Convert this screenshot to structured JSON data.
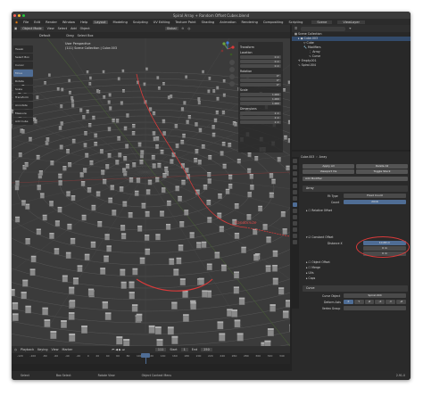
{
  "window": {
    "title": "Spiral Array + Random Offset Cubes.blend"
  },
  "menubar": {
    "items": [
      "File",
      "Edit",
      "Render",
      "Window",
      "Help",
      "Layout",
      "Modeling",
      "Sculpting",
      "UV Editing",
      "Texture Paint",
      "Shading",
      "Animation",
      "Rendering",
      "Compositing",
      "Scripting"
    ],
    "scene": "Scene",
    "view_layer": "ViewLayer"
  },
  "viewport_header": {
    "mode": "Object Mode",
    "menus": [
      "View",
      "Select",
      "Add",
      "Object"
    ],
    "orientation": "Default",
    "drag": "Drag",
    "select_box": "Select Box",
    "transform": "Global"
  },
  "viewport": {
    "info_line1": "User Perspective",
    "info_line2": "(111) Scene Collection | Cube.003",
    "annotation": "Randomize",
    "tools": [
      "Tweak",
      "Select Box",
      "Cursor",
      "Move",
      "Rotate",
      "Scale",
      "Transform",
      "Annotate",
      "Measure",
      "Add Cube"
    ],
    "selected_tool_index": 3
  },
  "npanel": {
    "sections": [
      "Transform",
      "Location",
      "Rotation",
      "Scale",
      "Dimensions"
    ],
    "values": [
      "0 m",
      "0 m",
      "0 m",
      "0°",
      "0°",
      "0°",
      "1.000",
      "1.000",
      "1.000",
      "2 m",
      "2 m",
      "2 m"
    ]
  },
  "timeline": {
    "menus": [
      "Playback",
      "Keying",
      "View",
      "Marker"
    ],
    "current_frame": "111",
    "start_label": "Start",
    "start": "1",
    "end_label": "End",
    "end": "250",
    "ticks": [
      "-120",
      "-100",
      "-80",
      "-60",
      "-40",
      "-20",
      "0",
      "20",
      "40",
      "60",
      "80",
      "100",
      "120",
      "140",
      "160",
      "180",
      "200",
      "220",
      "240",
      "260",
      "280",
      "300",
      "320",
      "340"
    ]
  },
  "statusbar": {
    "items": [
      "Select",
      "Box Select",
      "Rotate View",
      "Object Context Menu"
    ],
    "version": "2.91.0"
  },
  "outliner": {
    "search_placeholder": "",
    "rows": [
      "Scene Collection",
      "Cube.003",
      "Cube",
      "Modifiers",
      "Array",
      "Curve",
      "Empty.001",
      "Spiral.004"
    ]
  },
  "properties": {
    "object": "Cube.003",
    "modifier_tab": "Array",
    "apply_all": "Apply All",
    "delete_all": "Delete All",
    "viewport_vis": "Viewport Vis",
    "toggle_stack": "Toggle Stack",
    "add_modifier": "Add Modifier",
    "array_name": "Array",
    "fit_type_label": "Fit Type",
    "fit_type": "Fixed Count",
    "count_label": "Count",
    "count": "2016",
    "relative_offset": "Relative Offset",
    "constant_offset": "Constant Offset",
    "distance_label": "Distance X",
    "distance_x": "10.88 m",
    "distance_y": "0 m",
    "distance_z": "0 m",
    "object_offset": "Object Offset",
    "merge": "Merge",
    "uvs": "UVs",
    "caps": "Caps",
    "curve_name": "Curve",
    "curve_object_label": "Curve Object",
    "curve_object": "Spiral.004",
    "deform_axis_label": "Deform Axis",
    "deform_axis": [
      "X",
      "Y",
      "Z",
      "-X",
      "-Y",
      "-Z"
    ],
    "vertex_group_label": "Vertex Group"
  },
  "colors": {
    "accent": "#4f6d95",
    "highlight": "#d93a3a",
    "bg": "#232323"
  }
}
